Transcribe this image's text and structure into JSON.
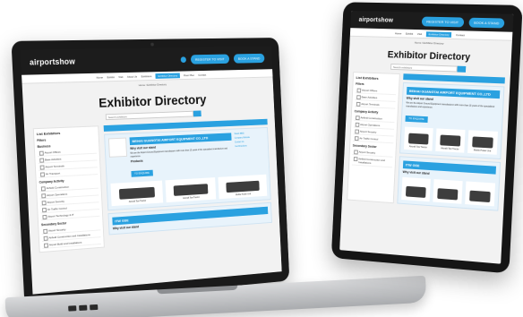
{
  "site": {
    "logo": "airportshow",
    "nav": [
      "Home",
      "Exhibit",
      "Visit",
      "About Us",
      "Exhibitors",
      "Exhibitor Directory",
      "Floor Plan",
      "Contact"
    ],
    "breadcrumb": "Home / Exhibitor Directory",
    "title": "Exhibitor Directory",
    "search_placeholder": "Search exhibitors",
    "buttons": {
      "primary": "REGISTER TO VISIT",
      "secondary": "BOOK A STAND"
    }
  },
  "sidebar": {
    "title": "List Exhibitors",
    "filters_label": "Filters",
    "groups": [
      {
        "heading": "Business",
        "items": [
          "Airport Offices",
          "Base Activities",
          "Airport Terminals",
          "Air Transport"
        ]
      },
      {
        "heading": "Company Activity",
        "items": [
          "Airfield Construction",
          "Airport Operations",
          "Airport Security",
          "Air Traffic Control",
          "Airport Technology & IT"
        ]
      },
      {
        "heading": "Secondary Sector",
        "items": [
          "Airport Security",
          "Airfield Construction and Installations",
          "Airport Build and Installations"
        ]
      }
    ]
  },
  "results": {
    "card1": {
      "company": "BEIHAI GUANGTAI AIRPORT EQUIPMENT CO.,LTD",
      "about_heading": "Why visit our stand",
      "about": "We are the Airport Ground Equipment manufacturer with more than 15 years of the specialized manufacture and experience.",
      "contacts": [
        "Stand #B65",
        "Company Website",
        "Contact Us",
        "Get Directions"
      ],
      "product_heading": "Products",
      "button": "TO ENQUIRE",
      "products": [
        "Aircraft Tow Tractor",
        "Aircraft Tow Tractor",
        "Mobile Power Unit"
      ]
    },
    "card2": {
      "company": "ITW GSE",
      "about_heading": "Why visit our stand"
    }
  }
}
